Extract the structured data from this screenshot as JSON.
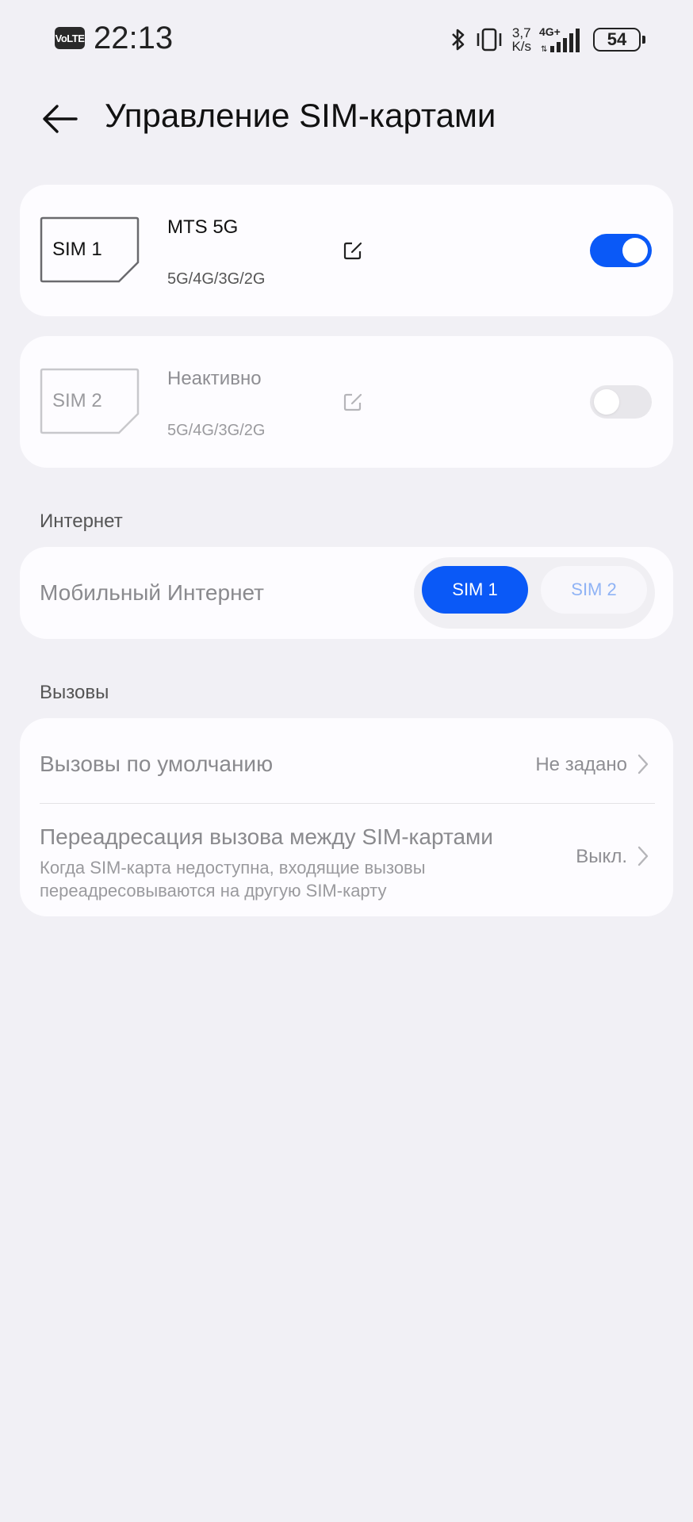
{
  "status_bar": {
    "volte": "VoLTE",
    "time": "22:13",
    "speed_value": "3,7",
    "speed_unit": "K/s",
    "network": "4G+",
    "battery": "54"
  },
  "header": {
    "title": "Управление SIM-картами"
  },
  "sims": [
    {
      "card_label": "SIM 1",
      "name": "MTS 5G",
      "network": "5G/4G/3G/2G",
      "enabled": true
    },
    {
      "card_label": "SIM 2",
      "name": "Неактивно",
      "network": "5G/4G/3G/2G",
      "enabled": false
    }
  ],
  "internet": {
    "section_label": "Интернет",
    "mobile_data_label": "Мобильный Интернет",
    "options": [
      "SIM 1",
      "SIM 2"
    ],
    "selected": "SIM 1"
  },
  "calls": {
    "section_label": "Вызовы",
    "default_calls": {
      "label": "Вызовы по умолчанию",
      "value": "Не задано"
    },
    "forwarding": {
      "label": "Переадресация вызова между SIM-картами",
      "description_line1": "Когда SIM-карта недоступна, входящие вызовы",
      "description_line2": "переадресовываются на другую SIM-карту",
      "value": "Выкл."
    }
  },
  "colors": {
    "accent": "#0a59f7",
    "background": "#f1f0f5",
    "card": "#fdfcff"
  }
}
